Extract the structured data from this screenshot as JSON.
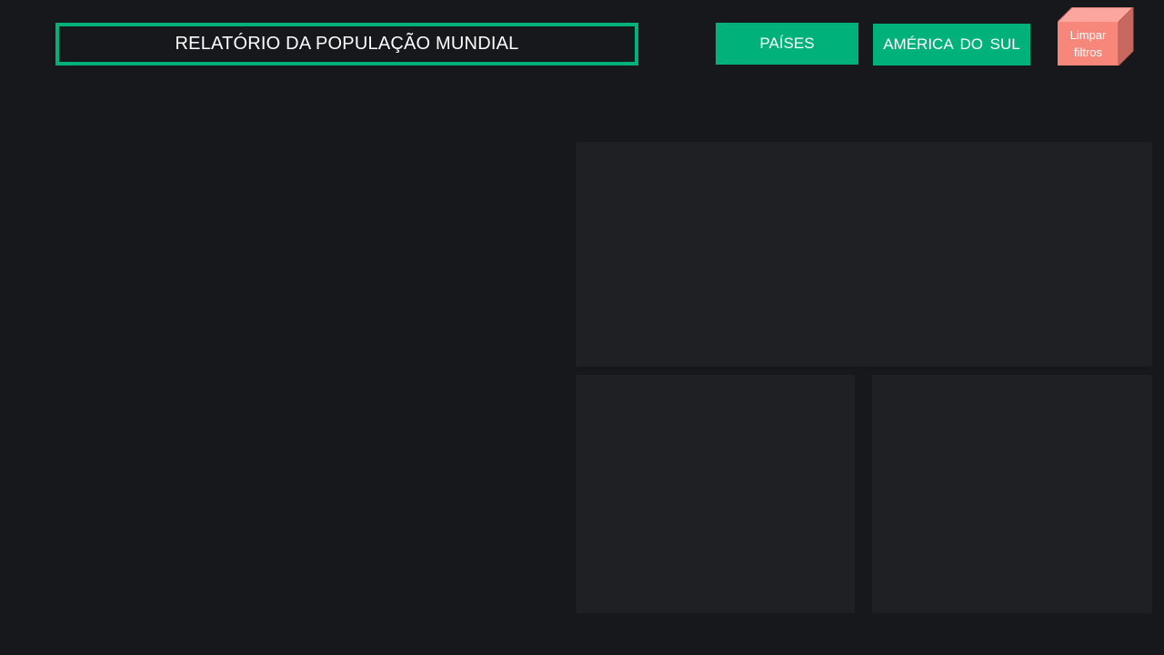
{
  "header": {
    "title": "RELATÓRIO DA POPULAÇÃO MUNDIAL"
  },
  "filters": {
    "countries_label": "PAÍSES",
    "region_label": "AMÉRICA DO SUL",
    "clear_label": "Limpar\nfiltros"
  },
  "colors": {
    "background": "#17181c",
    "accent_green": "#00b27a",
    "clear_button": "#f8877b",
    "panel": "#1f2024"
  }
}
